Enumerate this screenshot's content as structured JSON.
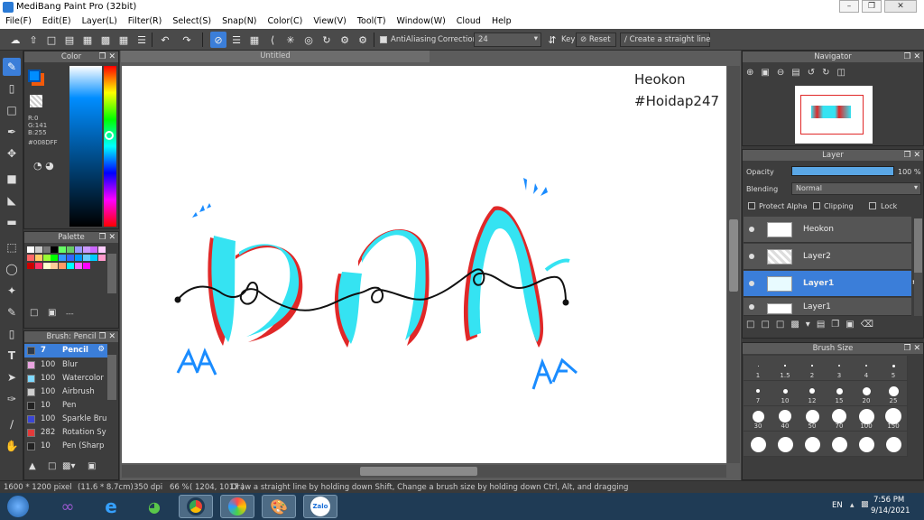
{
  "window": {
    "title": "MediBang Paint Pro (32bit)"
  },
  "menu": [
    "File(F)",
    "Edit(E)",
    "Layer(L)",
    "Filter(R)",
    "Select(S)",
    "Snap(N)",
    "Color(C)",
    "View(V)",
    "Tool(T)",
    "Window(W)",
    "Cloud",
    "Help"
  ],
  "toolbar": {
    "antialiasing": "AntiAliasing",
    "correction_label": "Correction",
    "correction_value": "24",
    "key_label": "Key",
    "reset": "Reset",
    "straight_line": "Create a straight line"
  },
  "color_panel": {
    "title": "Color",
    "r": "R:0",
    "g": "G:141",
    "b": "B:255",
    "hex": "#008DFF",
    "main_color": "#008DFF",
    "sub_color": "#F25A0A"
  },
  "palette_panel": {
    "title": "Palette",
    "dashes": "---"
  },
  "brush_panel": {
    "title": "Brush: Pencil",
    "items": [
      {
        "size": "7",
        "name": "Pencil",
        "color": "#2e3a4a"
      },
      {
        "size": "100",
        "name": "Blur",
        "color": "#e9a4e0"
      },
      {
        "size": "100",
        "name": "Watercolor",
        "color": "#7fd9ff"
      },
      {
        "size": "100",
        "name": "Airbrush",
        "color": "#cfcfcf"
      },
      {
        "size": "10",
        "name": "Pen",
        "color": "#222222"
      },
      {
        "size": "100",
        "name": "Sparkle Bru",
        "color": "#3a46d6"
      },
      {
        "size": "282",
        "name": "Rotation Sy",
        "color": "#e23a3a"
      },
      {
        "size": "10",
        "name": "Pen (Sharp",
        "color": "#222222"
      }
    ]
  },
  "document": {
    "tab": "Untitled",
    "canvas_text_1": "Heokon",
    "canvas_text_2": "#Hoidap247"
  },
  "navigator": {
    "title": "Navigator"
  },
  "layer_panel": {
    "title": "Layer",
    "opacity_label": "Opacity",
    "opacity_value": "100 %",
    "opacity_fraction": 1.0,
    "blending_label": "Blending",
    "blending_value": "Normal",
    "protect_alpha": "Protect Alpha",
    "clipping": "Clipping",
    "lock": "Lock",
    "layers": [
      {
        "name": "Heokon",
        "selected": false
      },
      {
        "name": "Layer2",
        "selected": false
      },
      {
        "name": "Layer1",
        "selected": true
      },
      {
        "name": "Layer1",
        "selected": false
      }
    ]
  },
  "brush_size_panel": {
    "title": "Brush Size",
    "sizes": [
      "1",
      "1.5",
      "2",
      "3",
      "4",
      "5",
      "7",
      "10",
      "12",
      "15",
      "20",
      "25",
      "30",
      "40",
      "50",
      "70",
      "100",
      "150",
      "",
      "",
      "",
      "",
      "",
      ""
    ]
  },
  "status": {
    "dimensions": "1600 * 1200 pixel",
    "physical": "(11.6 * 8.7cm)",
    "dpi": "350 dpi",
    "zoom": "66 %",
    "coords": "( 1204, 1017 )",
    "hint": "Draw a straight line by holding down Shift, Change a brush size by holding down Ctrl, Alt, and dragging"
  },
  "taskbar": {
    "language": "EN",
    "time": "7:56 PM",
    "date": "9/14/2021",
    "zalo": "Zalo"
  }
}
